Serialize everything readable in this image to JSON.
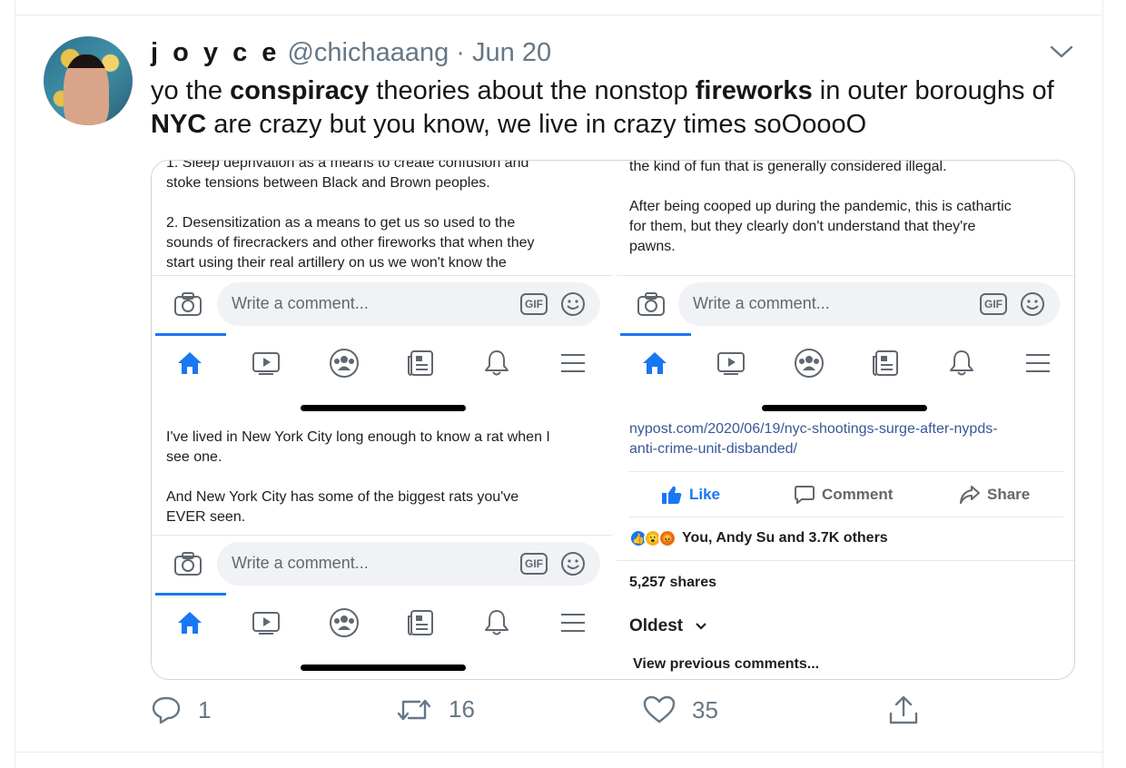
{
  "tweet": {
    "display_name": "j o y c e",
    "handle": "@chichaaang",
    "separator": "·",
    "date": "Jun 20",
    "text_parts": [
      {
        "t": "yo the ",
        "b": false
      },
      {
        "t": "conspiracy",
        "b": true
      },
      {
        "t": " theories about the nonstop ",
        "b": false
      },
      {
        "t": "fireworks",
        "b": true
      },
      {
        "t": " in outer boroughs of ",
        "b": false
      },
      {
        "t": "NYC",
        "b": true
      },
      {
        "t": " are crazy but you know, we live in crazy times soOoooO",
        "b": false
      }
    ],
    "actions": {
      "reply_count": "1",
      "retweet_count": "16",
      "like_count": "35"
    }
  },
  "media": {
    "top_left": {
      "lines": [
        "1. Sleep deprivation as a means to create confusion and",
        "stoke tensions between Black and Brown peoples.",
        "",
        "2. Desensitization as a means to get us so used to the",
        "sounds of firecrackers and other fireworks that when they",
        "start using their real artillery on us we won't know the"
      ]
    },
    "top_right": {
      "lines": [
        "the kind of fun that is generally considered illegal.",
        "",
        "After being cooped up during the pandemic, this is cathartic",
        "for them, but they clearly don't understand that they're",
        "pawns."
      ]
    },
    "bottom_left": {
      "lines": [
        "I've lived in New York City long enough to know a rat when I",
        "see one.",
        "",
        "And New York City has some of the biggest rats you've",
        "EVER seen."
      ]
    },
    "bottom_right": {
      "link_line1": "nypost.com/2020/06/19/nyc-shootings-surge-after-nypds-",
      "link_line2": "anti-crime-unit-disbanded/",
      "like_label": "Like",
      "comment_label": "Comment",
      "share_label": "Share",
      "reactions_text": "You, Andy Su and 3.7K others",
      "shares_text": "5,257 shares",
      "sort_label": "Oldest",
      "view_previous": "View previous comments..."
    },
    "comment_placeholder": "Write a comment...",
    "gif_label": "GIF",
    "nav_icons": [
      "home-icon",
      "watch-icon",
      "groups-icon",
      "news-icon",
      "bell-icon",
      "menu-icon"
    ]
  },
  "colors": {
    "fb_blue": "#1877f2",
    "twitter_grey": "#657786",
    "link_blue": "#385898"
  }
}
